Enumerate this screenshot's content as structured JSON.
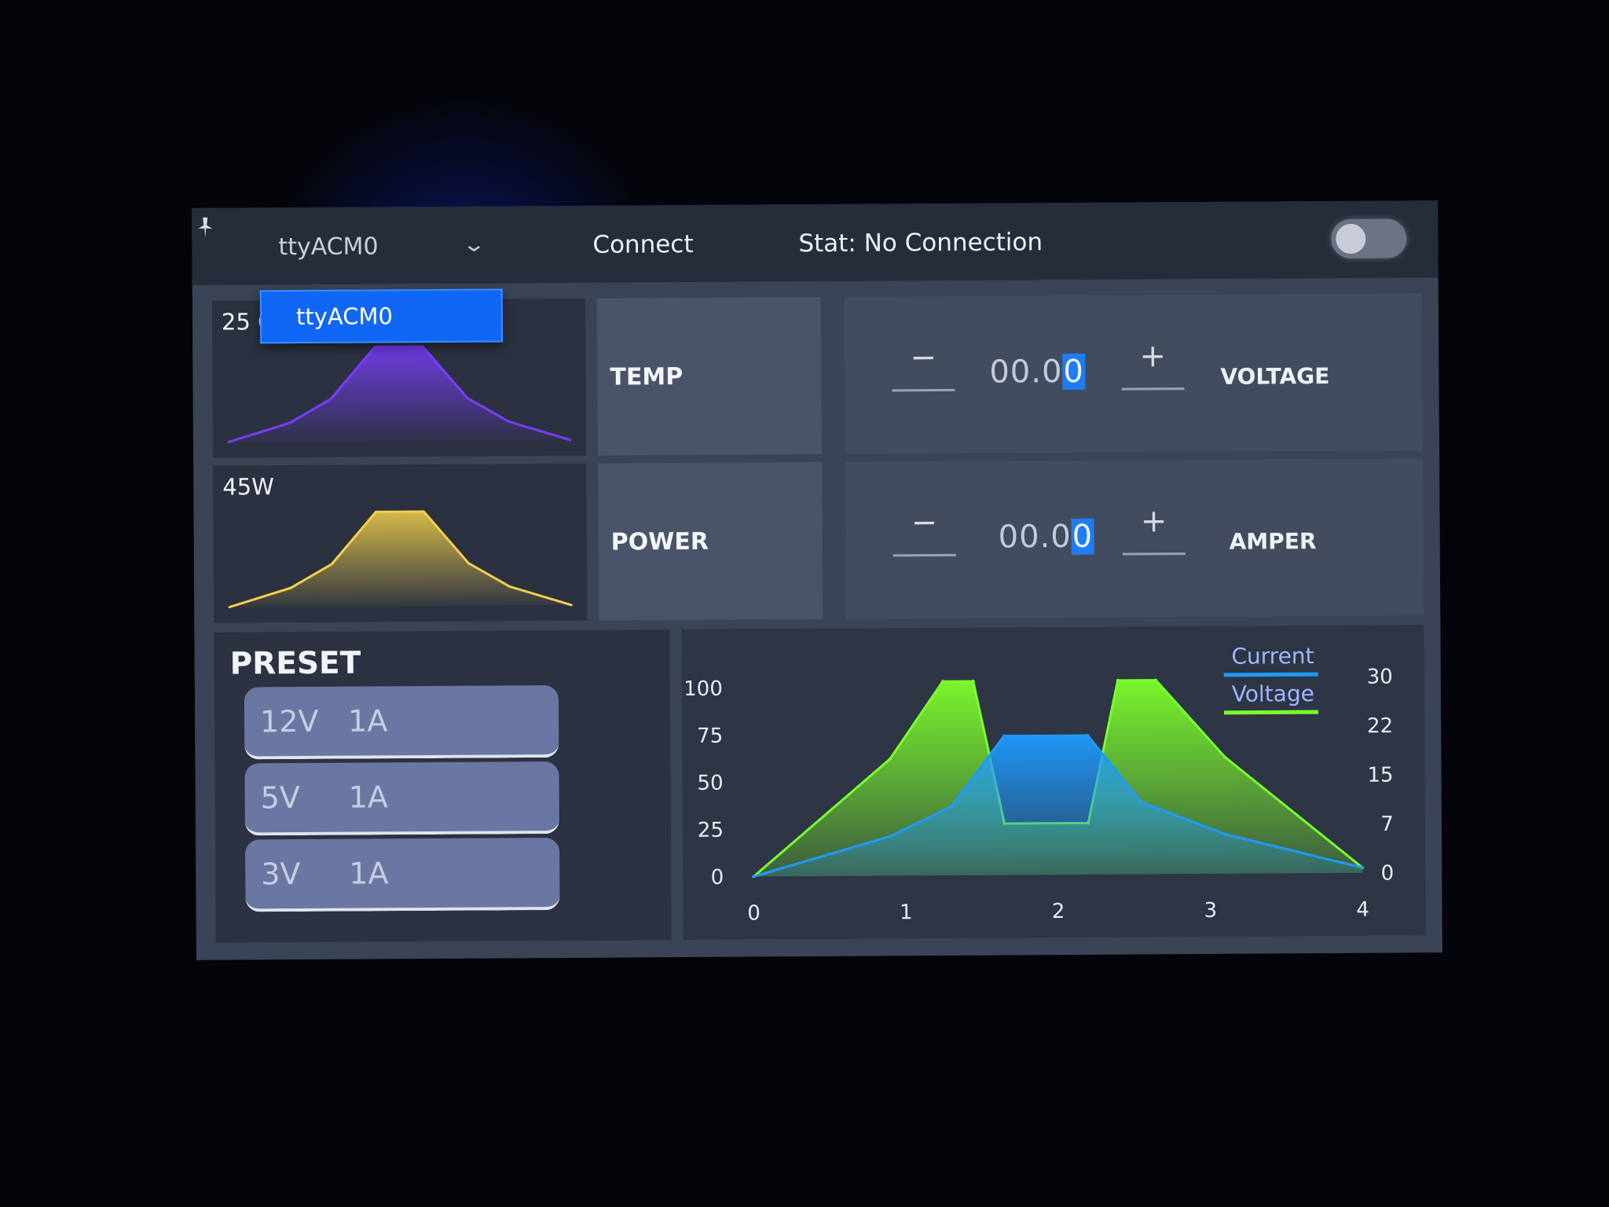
{
  "topbar": {
    "app_icon": "pin-icon",
    "port_selected": "ttyACM0",
    "connect_label": "Connect",
    "status_text": "Stat: No Connection",
    "toggle_on": false
  },
  "dropdown": {
    "options": [
      "ttyACM0"
    ]
  },
  "tiles": {
    "temp": {
      "reading": "25 C",
      "label": "TEMP"
    },
    "power": {
      "reading": "45W",
      "label": "POWER"
    }
  },
  "controls": {
    "voltage": {
      "minus": "−",
      "value_main": "00.0",
      "value_cursor": "0",
      "plus": "+",
      "label": "VOLTAGE"
    },
    "amper": {
      "minus": "−",
      "value_main": "00.0",
      "value_cursor": "0",
      "plus": "+",
      "label": "AMPER"
    }
  },
  "preset": {
    "title": "PRESET",
    "items": [
      {
        "voltage": "12V",
        "current": "1A"
      },
      {
        "voltage": "5V",
        "current": "1A"
      },
      {
        "voltage": "3V",
        "current": "1A"
      }
    ]
  },
  "colors": {
    "temp_line": "#7a3dff",
    "power_line": "#f2d04a",
    "current_series": "#1e9bff",
    "voltage_series": "#7cff2a",
    "highlight": "#1167f5"
  },
  "chart_data": [
    {
      "type": "area",
      "series": [
        {
          "values": [
            0,
            20,
            45,
            100,
            100,
            45,
            20,
            0
          ]
        }
      ]
    },
    {
      "type": "area",
      "series": [
        {
          "values": [
            0,
            20,
            45,
            100,
            100,
            45,
            20,
            0
          ]
        }
      ]
    },
    {
      "type": "area",
      "x": [
        0,
        0.9,
        1.25,
        1.6,
        2.2,
        2.45,
        3.1,
        4
      ],
      "xticks": [
        "0",
        "1",
        "2",
        "3",
        "4"
      ],
      "yticks_left": [
        "100",
        "75",
        "50",
        "25",
        "0"
      ],
      "yticks_right": [
        "30",
        "22",
        "15",
        "7",
        "0"
      ],
      "ylim": [
        0,
        100
      ],
      "xlim": [
        0,
        4
      ],
      "legend_position": "top-right",
      "series": [
        {
          "name": "Current",
          "x": [
            0,
            0.9,
            1.3,
            1.65,
            2.2,
            2.55,
            3.1,
            4
          ],
          "values": [
            0,
            23,
            40,
            81,
            81,
            42,
            23,
            3
          ]
        },
        {
          "name": "Voltage",
          "x": [
            0,
            0.9,
            1.25,
            1.45,
            1.65,
            2.2,
            2.4,
            2.65,
            3.1,
            4
          ],
          "values": [
            0,
            68,
            113,
            113,
            30,
            30,
            113,
            113,
            68,
            3
          ]
        }
      ]
    }
  ]
}
